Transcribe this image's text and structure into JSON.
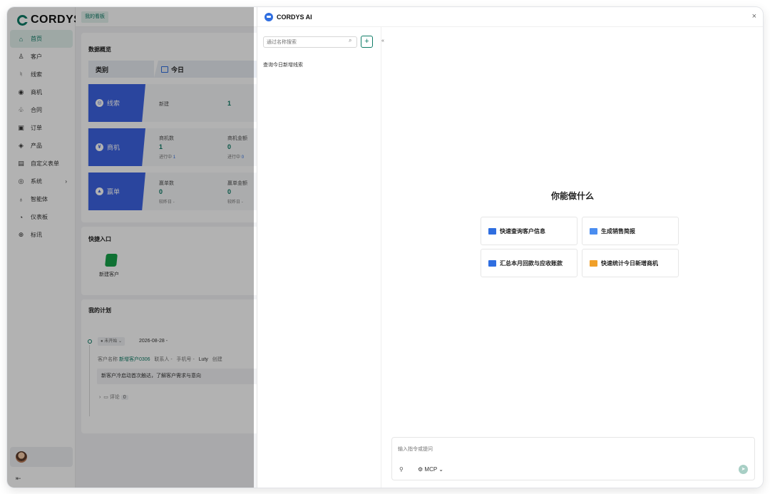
{
  "app": {
    "logo_text": "CORDYS"
  },
  "sidebar": {
    "items": [
      {
        "icon": "⌂",
        "label": "首页"
      },
      {
        "icon": "♙",
        "label": "客户"
      },
      {
        "icon": "♮",
        "label": "线索"
      },
      {
        "icon": "◉",
        "label": "商机"
      },
      {
        "icon": "♧",
        "label": "合同"
      },
      {
        "icon": "▣",
        "label": "订单"
      },
      {
        "icon": "◈",
        "label": "产品"
      },
      {
        "icon": "▤",
        "label": "自定义表单"
      },
      {
        "icon": "◎",
        "label": "系统",
        "arrow": "›"
      },
      {
        "icon": "♁",
        "label": "智能体"
      },
      {
        "icon": "◔",
        "label": "仪表板"
      },
      {
        "icon": "⊕",
        "label": "标讯"
      }
    ],
    "collapse_icon": "⇤"
  },
  "topbar": {
    "tab": "我的看板"
  },
  "overview": {
    "title": "数据概览",
    "col_category": "类别",
    "col_period": "今日",
    "rows": [
      {
        "name": "线索",
        "metrics": [
          {
            "label": "新建",
            "value": "1"
          }
        ]
      },
      {
        "name": "商机",
        "metrics": [
          {
            "label": "商机数",
            "value": "1",
            "sub_label": "进行中",
            "sub_value": "1"
          },
          {
            "label": "商机金额",
            "value": "0",
            "sub_label": "进行中",
            "sub_value": "0"
          }
        ]
      },
      {
        "name": "赢单",
        "metrics": [
          {
            "label": "赢单数",
            "value": "0",
            "sub_label": "较昨日",
            "sub_value": "-"
          },
          {
            "label": "赢单金额",
            "value": "0",
            "sub_label": "较昨日",
            "sub_value": "-"
          }
        ]
      }
    ]
  },
  "quick": {
    "title": "快捷入口",
    "items": [
      {
        "label": "新建客户"
      }
    ]
  },
  "plan": {
    "title": "我的计划",
    "status": "未开始",
    "date": "2026-08-28",
    "date_suffix": "-",
    "customer_label": "客户名称",
    "customer_value": "新增客户0306",
    "contact_label": "联系人",
    "contact_value": "-",
    "phone_label": "手机号",
    "phone_value": "-",
    "owner": "Luty",
    "creator_label": "创建",
    "content": "新客户冷启动首次触达，了解客户需求与意向",
    "comment_label": "评论",
    "comment_count": "0"
  },
  "ai": {
    "title": "CORDYS AI",
    "close": "×",
    "search_placeholder": "通过名称搜索",
    "add": "+",
    "fold": "«",
    "history": [
      "查询今日新增线索"
    ],
    "heading": "你能做什么",
    "suggestions": [
      {
        "label": "快速查询客户信息",
        "color": "#2f6ee0"
      },
      {
        "label": "生成销售简报",
        "color": "#4a8df0"
      },
      {
        "label": "汇总本月回款与应收账款",
        "color": "#2f6ee0"
      },
      {
        "label": "快速统计今日新增商机",
        "color": "#f0a02a"
      }
    ],
    "input_placeholder": "输入指令或提问",
    "attach": "⚲",
    "mcp_label": "MCP",
    "mcp_caret": "⌄",
    "send": "➤"
  }
}
